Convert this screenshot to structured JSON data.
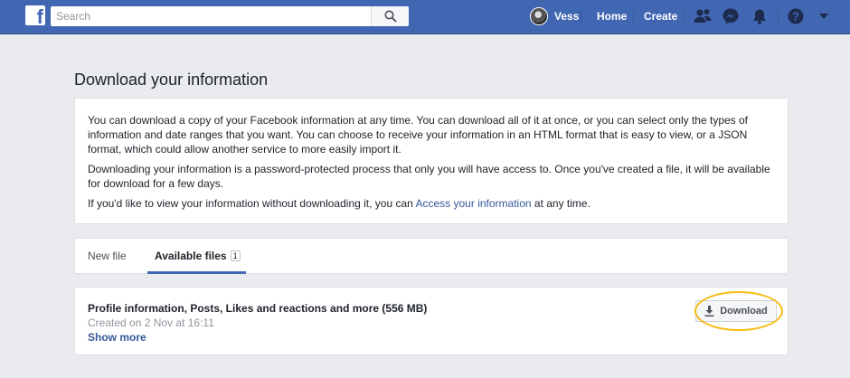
{
  "topbar": {
    "search_placeholder": "Search",
    "user_name": "Vess",
    "home_label": "Home",
    "create_label": "Create",
    "icons": [
      "facebook-logo",
      "search-icon",
      "friends-icon",
      "messenger-icon",
      "notifications-icon",
      "help-icon",
      "chevron-down-icon"
    ],
    "brand_color": "#4267b2"
  },
  "page": {
    "title": "Download your information"
  },
  "info": {
    "para1": "You can download a copy of your Facebook information at any time. You can download all of it at once, or you can select only the types of information and date ranges that you want. You can choose to receive your information in an HTML format that is easy to view, or a JSON format, which could allow another service to more easily import it.",
    "para2": "Downloading your information is a password-protected process that only you will have access to. Once you've created a file, it will be available for download for a few days.",
    "para3_before": "If you'd like to view your information without downloading it, you can ",
    "para3_link": "Access your information",
    "para3_after": " at any time."
  },
  "tabs": {
    "new_file": "New file",
    "available_files": "Available files",
    "available_count": "1"
  },
  "file": {
    "title": "Profile information, Posts, Likes and reactions and more (556 MB)",
    "created": "Created on 2 Nov at 16:11",
    "show_more": "Show more",
    "download_label": "Download"
  }
}
